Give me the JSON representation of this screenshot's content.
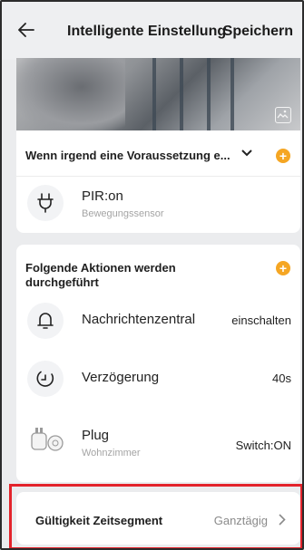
{
  "header": {
    "title": "Intelligente Einstellung",
    "save_label": "Speichern"
  },
  "condition": {
    "heading": "Wenn irgend eine Voraussetzung e...",
    "items": [
      {
        "title": "PIR:on",
        "subtitle": "Bewegungssensor",
        "icon": "plug-icon"
      }
    ]
  },
  "actions": {
    "heading": "Folgende Aktionen werden durchgeführt",
    "items": [
      {
        "title": "Nachrichtenzentral",
        "value": "einschalten",
        "icon": "bell-icon"
      },
      {
        "title": "Verzögerung",
        "value": "40s",
        "icon": "clock-icon"
      },
      {
        "title": "Plug",
        "subtitle": "Wohnzimmer",
        "value": "Switch:ON",
        "icon": "smart-plug-icon"
      }
    ]
  },
  "validity": {
    "label": "Gültigkeit Zeitsegment",
    "value": "Ganztägig"
  },
  "colors": {
    "accent": "#f5a623",
    "highlight": "#e3232b",
    "background": "#ebecee"
  }
}
